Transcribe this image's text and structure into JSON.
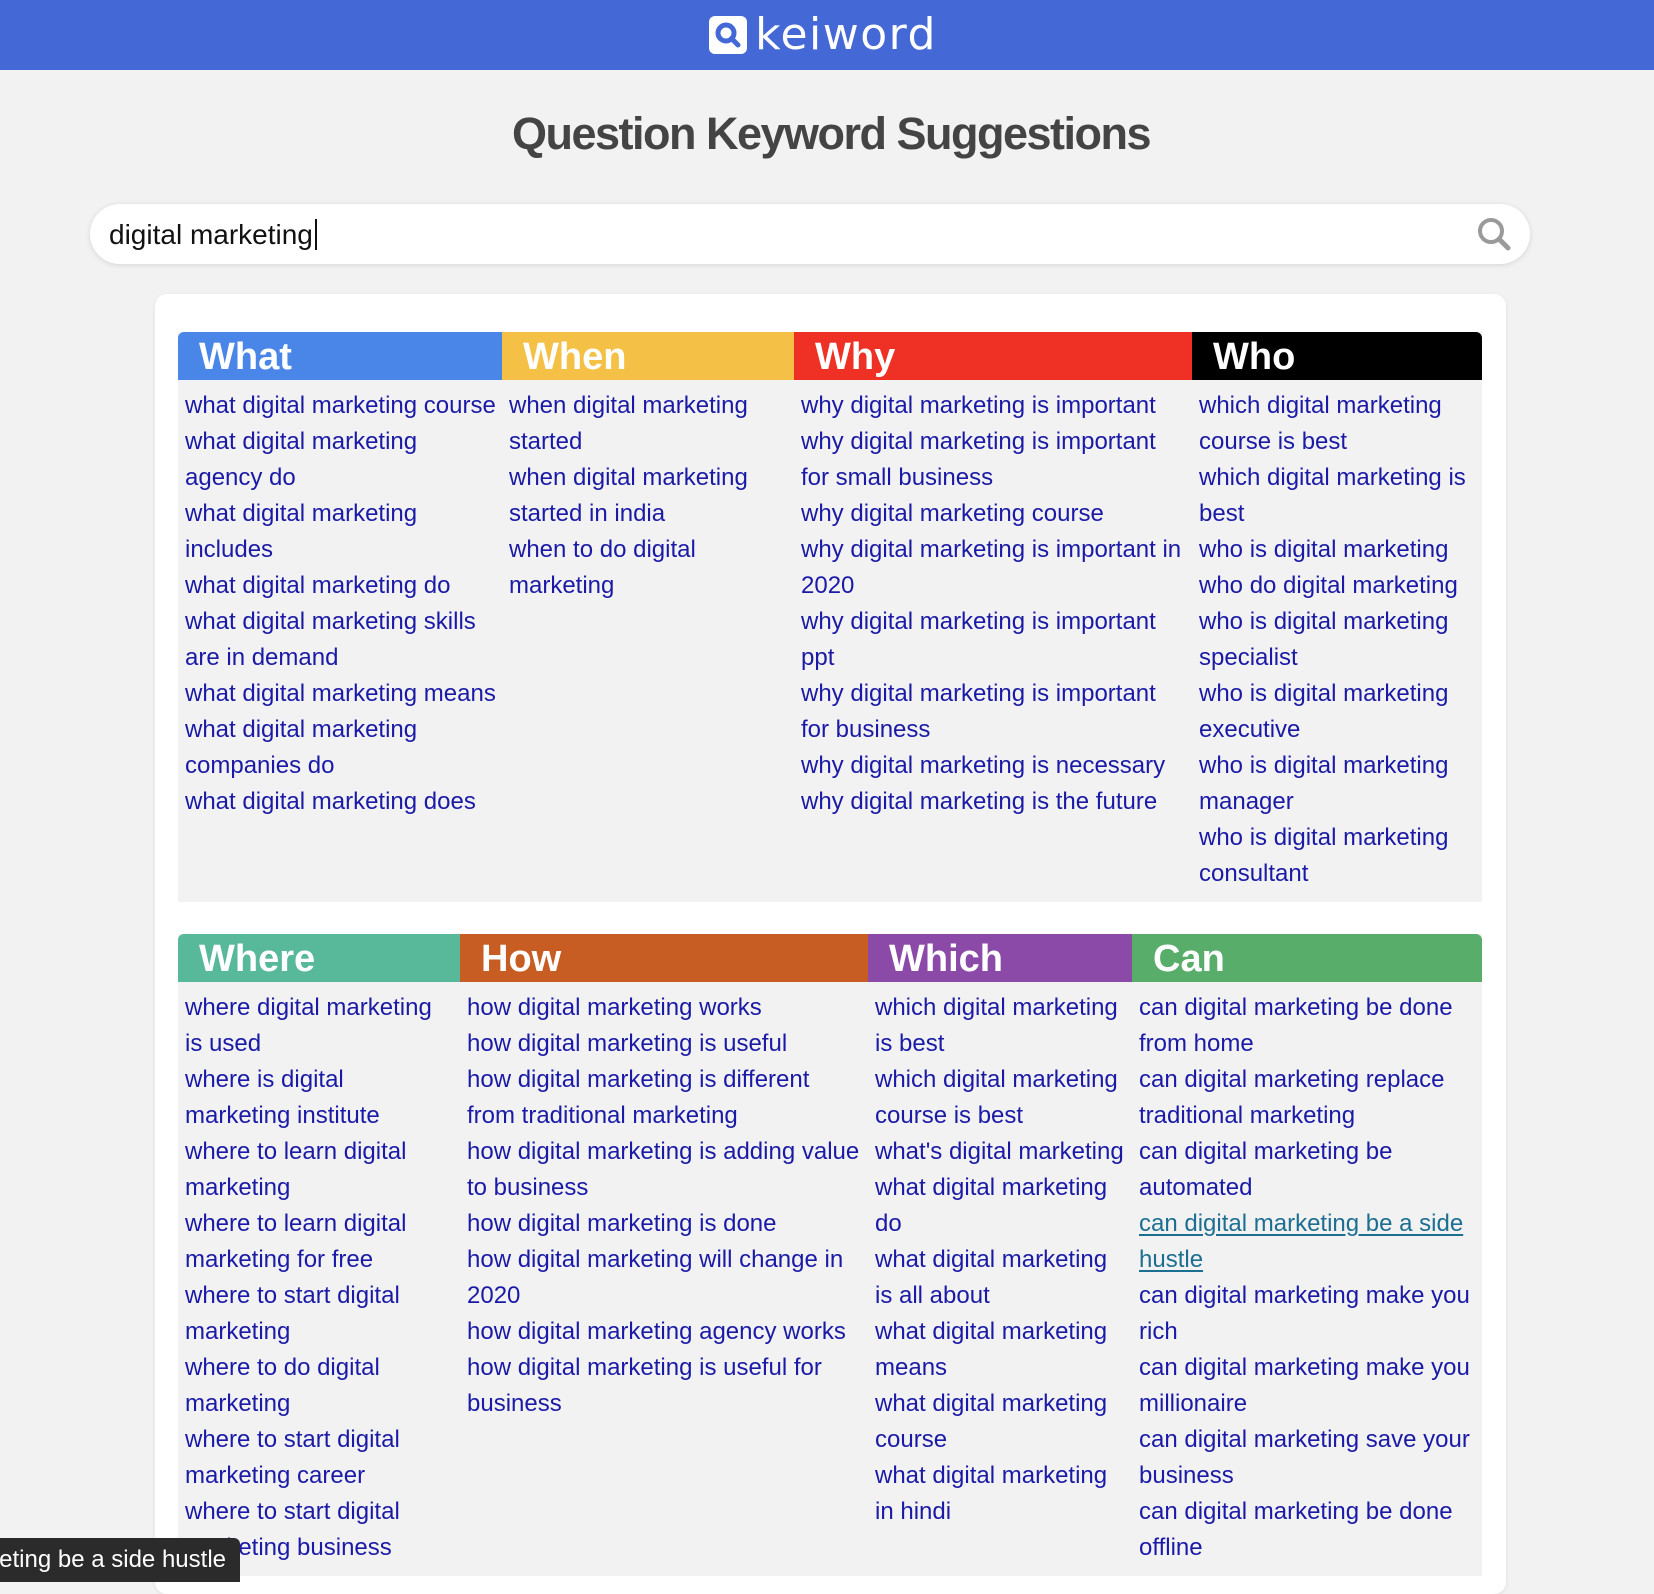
{
  "brand": {
    "name": "keiword",
    "icon": "search-icon"
  },
  "page_title": "Question Keyword Suggestions",
  "search": {
    "value": "digital marketing",
    "button_icon": "search-icon"
  },
  "colors": {
    "topbar": "#4469d6",
    "link": "#1a1aa6",
    "link_hover": "#1c6f91",
    "what": "#4a86e8",
    "when": "#f4c045",
    "why": "#ee3124",
    "who": "#000000",
    "where": "#58b89a",
    "how": "#c85d24",
    "which": "#8b4aa8",
    "can": "#57ad69"
  },
  "groups": [
    {
      "columns": [
        {
          "key": "what",
          "title": "What",
          "items": [
            "what digital marketing course",
            "what digital marketing agency do",
            "what digital marketing includes",
            "what digital marketing do",
            "what digital marketing skills are in demand",
            "what digital marketing means",
            "what digital marketing companies do",
            "what digital marketing does"
          ]
        },
        {
          "key": "when",
          "title": "When",
          "items": [
            "when digital marketing started",
            "when digital marketing started in india",
            "when to do digital marketing"
          ]
        },
        {
          "key": "why",
          "title": "Why",
          "items": [
            "why digital marketing is important",
            "why digital marketing is important for small business",
            "why digital marketing course",
            "why digital marketing is important in 2020",
            "why digital marketing is important ppt",
            "why digital marketing is important for business",
            "why digital marketing is necessary",
            "why digital marketing is the future"
          ]
        },
        {
          "key": "who",
          "title": "Who",
          "items": [
            "which digital marketing course is best",
            "which digital marketing is best",
            "who is digital marketing",
            "who do digital marketing",
            "who is digital marketing specialist",
            "who is digital marketing executive",
            "who is digital marketing manager",
            "who is digital marketing consultant"
          ]
        }
      ]
    },
    {
      "columns": [
        {
          "key": "where",
          "title": "Where",
          "items": [
            "where digital marketing is used",
            "where is digital marketing institute",
            "where to learn digital marketing",
            "where to learn digital marketing for free",
            "where to start digital marketing",
            "where to do digital marketing",
            "where to start digital marketing career",
            "where to start digital marketing business"
          ]
        },
        {
          "key": "how",
          "title": "How",
          "items": [
            "how digital marketing works",
            "how digital marketing is useful",
            "how digital marketing is different from traditional marketing",
            "how digital marketing is adding value to business",
            "how digital marketing is done",
            "how digital marketing will change in 2020",
            "how digital marketing agency works",
            "how digital marketing is useful for business"
          ]
        },
        {
          "key": "which",
          "title": "Which",
          "items": [
            "which digital marketing is best",
            "which digital marketing course is best",
            "what's digital marketing",
            "what digital marketing do",
            "what digital marketing is all about",
            "what digital marketing means",
            "what digital marketing course",
            "what digital marketing in hindi"
          ]
        },
        {
          "key": "can",
          "title": "Can",
          "items": [
            "can digital marketing be done from home",
            "can digital marketing replace traditional marketing",
            "can digital marketing be automated",
            "can digital marketing be a side hustle",
            "can digital marketing make you rich",
            "can digital marketing make you millionaire",
            "can digital marketing save your business",
            "can digital marketing be done offline"
          ]
        }
      ]
    }
  ],
  "hovered_item": "can digital marketing be a side hustle",
  "tooltip": {
    "text": "can digital marketing be a side hustle"
  }
}
